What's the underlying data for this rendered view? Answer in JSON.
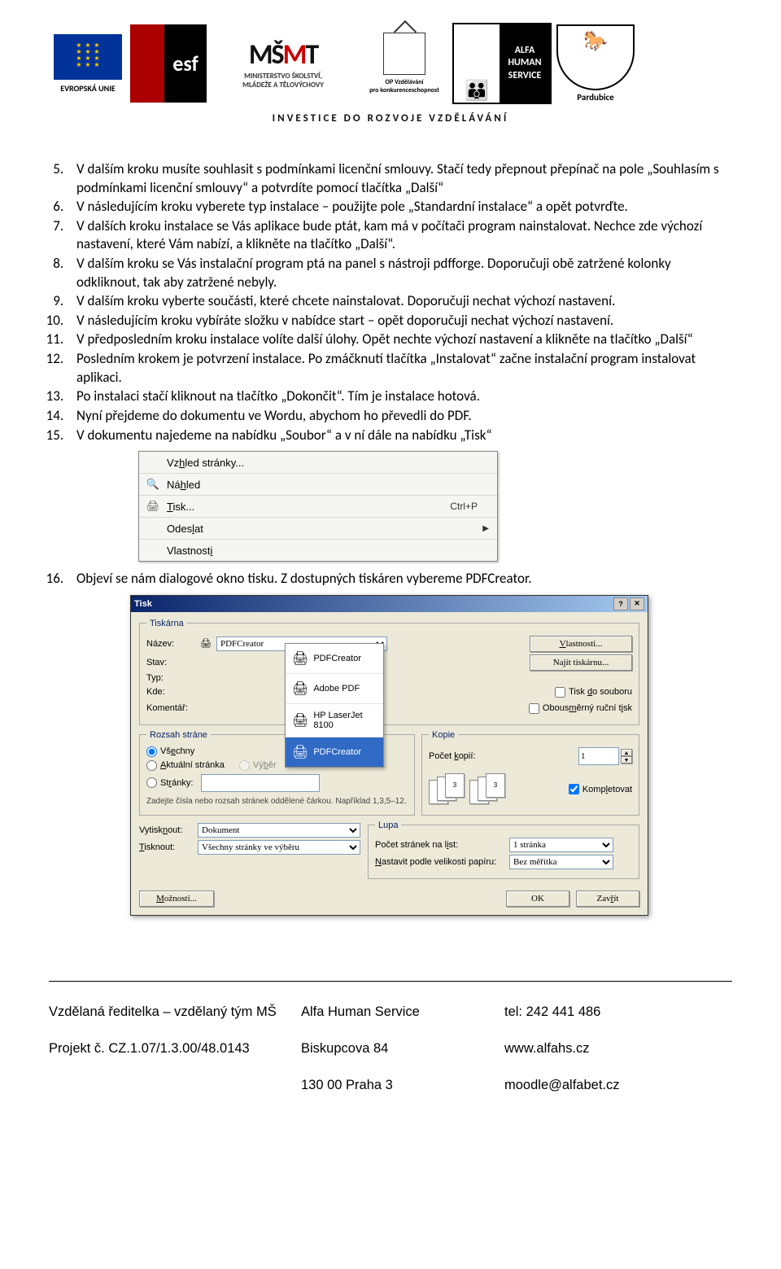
{
  "header": {
    "eu_label": "EVROPSKÁ UNIE",
    "esf": "esf",
    "msmt_line1": "MINISTERSTVO ŠKOLSTVÍ,",
    "msmt_line2": "MLÁDEŽE A TĚLOVÝCHOVY",
    "opvk_line1": "OP Vzdělávání",
    "opvk_line2": "pro konkurenceschopnost",
    "ahs": "ALFA HUMAN SERVICE",
    "pardubice": "Pardubice",
    "invest": "INVESTICE DO ROZVOJE VZDĚLÁVÁNÍ"
  },
  "list": {
    "start": 5,
    "items": [
      "V dalším kroku musíte souhlasit s podmínkami licenční smlouvy. Stačí tedy přepnout přepínač na pole „Souhlasím s podmínkami licenční smlouvy“ a potvrdíte pomocí tlačítka „Další“",
      "V následujícím kroku vyberete typ instalace – použijte pole „Standardní instalace“ a opět potvrďte.",
      "V dalších kroku instalace se Vás aplikace bude ptát, kam má v počítači program nainstalovat. Nechce zde výchozí nastavení, které Vám nabízí, a klikněte na tlačítko „Další“.",
      "V dalším kroku se Vás instalační program ptá na panel s nástroji pdfforge. Doporučuji obě zatržené kolonky odkliknout, tak aby zatržené nebyly.",
      "V dalším kroku vyberte součásti, které chcete nainstalovat. Doporučuji nechat výchozí nastavení.",
      "V následujícím kroku vybíráte složku v nabídce start – opět doporučuji nechat výchozí nastavení.",
      "V předposledním kroku instalace volíte další úlohy. Opět nechte výchozí nastavení a klikněte na tlačítko „Další“",
      "Posledním krokem je potvrzení instalace. Po zmáčknutí tlačítka „Instalovat“ začne instalační program instalovat aplikaci.",
      "Po instalaci stačí kliknout na tlačítko „Dokončit“. Tím je instalace hotová.",
      "Nyní přejdeme do dokumentu ve Wordu, abychom ho převedli do PDF.",
      "V dokumentu najedeme na nabídku „Soubor“ a v ní dále na nabídku „Tisk“"
    ],
    "item16": "Objeví se nám dialogové okno tisku. Z dostupných tiskáren vybereme PDFCreator."
  },
  "menu": {
    "items": [
      {
        "icon": "",
        "label": "Vzhled stránky...",
        "shortcut": "",
        "arrow": false
      },
      {
        "icon": "🔍",
        "label": "Náhled",
        "shortcut": "",
        "arrow": false
      },
      {
        "icon": "🖨",
        "label": "Tisk...",
        "shortcut": "Ctrl+P",
        "arrow": false
      },
      {
        "icon": "",
        "label": "Odeslat",
        "shortcut": "",
        "arrow": true
      },
      {
        "icon": "",
        "label": "Vlastnosti",
        "shortcut": "",
        "arrow": false
      }
    ]
  },
  "print": {
    "title": "Tisk",
    "printer_legend": "Tiskárna",
    "name_lbl": "Název:",
    "name_val": "PDFCreator",
    "state_lbl": "Stav:",
    "type_lbl": "Typ:",
    "where_lbl": "Kde:",
    "comment_lbl": "Komentář:",
    "properties_btn": "Vlastnosti...",
    "find_btn": "Najít tiskárnu...",
    "tofile": "Tisk do souboru",
    "duplex": "Obousměrný ruční tisk",
    "printers": [
      "PDFCreator",
      "Adobe PDF",
      "HP LaserJet 8100",
      "PDFCreator"
    ],
    "range_legend": "Rozsah stráne",
    "range_all": "Všechny",
    "range_current": "Aktuální stránka",
    "range_selection": "Výběr",
    "range_pages": "Stránky:",
    "range_note": "Zadejte čísla nebo rozsah stránek oddělené čárkou. Například 1,3,5–12.",
    "copies_legend": "Kopie",
    "copies_lbl": "Počet kopií:",
    "copies_val": "1",
    "collate": "Kompletovat",
    "magnify_legend": "Lupa",
    "pages_per_sheet_lbl": "Počet stránek na list:",
    "pages_per_sheet_val": "1 stránka",
    "scale_lbl": "Nastavit podle velikosti papíru:",
    "scale_val": "Bez měřítka",
    "printwhat_lbl": "Vytisknout:",
    "printwhat_val": "Dokument",
    "printpages_lbl": "Tisknout:",
    "printpages_val": "Všechny stránky ve výběru",
    "options_btn": "Možnosti...",
    "ok_btn": "OK",
    "close_btn": "Zavřít"
  },
  "footer": {
    "r1c1": "Vzdělaná ředitelka – vzdělaný tým MŠ",
    "r1c2": "Alfa Human Service",
    "r1c3": "tel: 242 441 486",
    "r2c1": "Projekt č. CZ.1.07/1.3.00/48.0143",
    "r2c2": "Biskupcova 84",
    "r2c3": "www.alfahs.cz",
    "r3c2": "130 00 Praha 3",
    "r3c3": "moodle@alfabet.cz"
  }
}
